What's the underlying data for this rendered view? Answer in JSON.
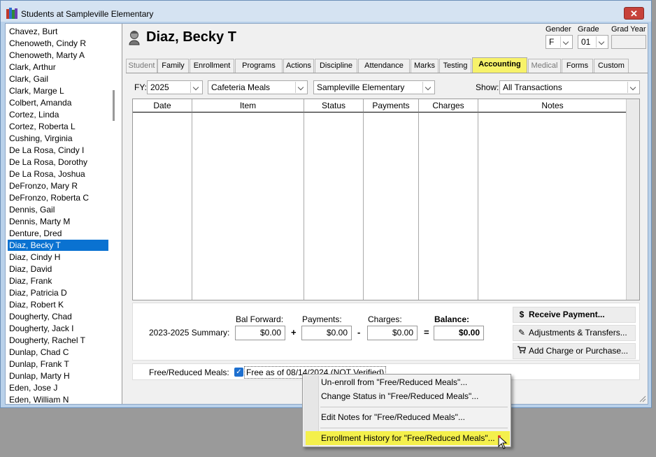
{
  "window": {
    "title": "Students at Sampleville Elementary",
    "close_label": "✕"
  },
  "students": [
    "Chavez, Burt",
    "Chenoweth, Cindy R",
    "Chenoweth, Marty A",
    "Clark, Arthur",
    "Clark, Gail",
    "Clark, Marge L",
    "Colbert, Amanda",
    "Cortez, Linda",
    "Cortez, Roberta L",
    "Cushing, Virginia",
    "De La Rosa, Cindy I",
    "De La Rosa, Dorothy",
    "De La Rosa, Joshua",
    "DeFronzo, Mary R",
    "DeFronzo, Roberta C",
    "Dennis, Gail",
    "Dennis, Marty M",
    "Denture, Dred",
    "Diaz, Becky T",
    "Diaz, Cindy H",
    "Diaz, David",
    "Diaz, Frank",
    "Diaz, Patricia D",
    "Diaz, Robert K",
    "Dougherty, Chad",
    "Dougherty, Jack I",
    "Dougherty, Rachel T",
    "Dunlap, Chad C",
    "Dunlap, Frank T",
    "Dunlap, Marty H",
    "Eden, Jose J",
    "Eden, William N"
  ],
  "selected_student": "Diaz, Becky T",
  "header": {
    "student_name": "Diaz, Becky T",
    "gender_label": "Gender",
    "gender_value": "F",
    "grade_label": "Grade",
    "grade_value": "01",
    "grad_year_label": "Grad Year",
    "grad_year_value": ""
  },
  "tabs": [
    "Student",
    "Family",
    "Enrollment",
    "Programs",
    "Actions",
    "Discipline",
    "Attendance",
    "Marks",
    "Testing",
    "Accounting",
    "Medical",
    "Forms",
    "Custom"
  ],
  "active_tab": "Accounting",
  "filters": {
    "fy_label": "FY:",
    "fy_value": "2025",
    "category_value": "Cafeteria Meals",
    "school_value": "Sampleville Elementary",
    "show_label": "Show:",
    "show_value": "All Transactions"
  },
  "grid": {
    "columns": [
      "Date",
      "Item",
      "Status",
      "Payments",
      "Charges",
      "Notes"
    ],
    "rows": []
  },
  "summary": {
    "label": "2023-2025 Summary:",
    "bal_forward_label": "Bal Forward:",
    "bal_forward": "$0.00",
    "payments_label": "Payments:",
    "payments": "$0.00",
    "charges_label": "Charges:",
    "charges": "$0.00",
    "balance_label": "Balance:",
    "balance": "$0.00",
    "op_plus": "+",
    "op_minus": "-",
    "op_equals": "="
  },
  "actions": {
    "receive_payment": "Receive Payment...",
    "adjustments": "Adjustments & Transfers...",
    "add_charge": "Add Charge or Purchase..."
  },
  "frm": {
    "label": "Free/Reduced Meals:",
    "checked": true,
    "status": "Free as of 08/14/2024 (NOT Verified)"
  },
  "context_menu": [
    "Un-enroll from \"Free/Reduced Meals\"...",
    "Change Status in \"Free/Reduced Meals\"...",
    "Edit Notes for \"Free/Reduced Meals\"...",
    "Enrollment History for \"Free/Reduced Meals\"..."
  ],
  "colors": {
    "highlight": "#f4f04c",
    "selection": "#0a72d1",
    "close": "#c7423a"
  }
}
